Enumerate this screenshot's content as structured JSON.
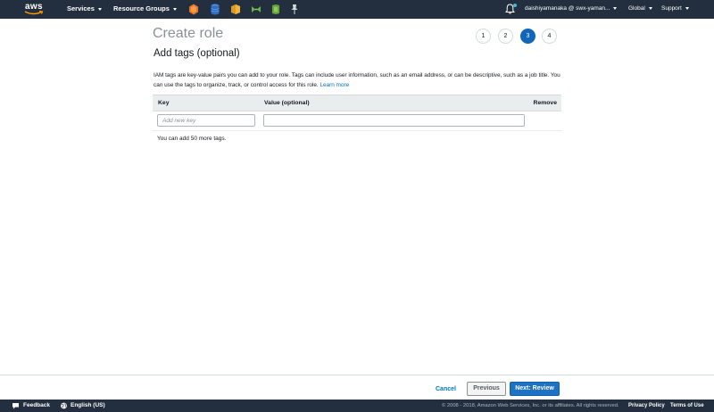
{
  "topnav": {
    "logo": "aws",
    "services_label": "Services",
    "resource_groups_label": "Resource Groups",
    "account_label": "daishiyamanaka @ swx-yaman...",
    "region_label": "Global",
    "support_label": "Support",
    "service_icons": [
      "cloudformation-icon",
      "rds-icon",
      "s3-icon",
      "codepipeline-icon",
      "lambda-icon",
      "pin-icon"
    ],
    "colors": {
      "bar": "#232f3e",
      "bell_dot": "#44b9d6"
    }
  },
  "page": {
    "title": "Create role",
    "section_title": "Add tags (optional)",
    "description": "IAM tags are key-value pairs you can add to your role. Tags can include user information, such as an email address, or can be descriptive, such as a job title. You can use the tags to organize, track, or control access for this role.",
    "learn_more": "Learn more",
    "steps": [
      {
        "label": "1",
        "active": false
      },
      {
        "label": "2",
        "active": false
      },
      {
        "label": "3",
        "active": true
      },
      {
        "label": "4",
        "active": false
      }
    ]
  },
  "tags_table": {
    "headers": {
      "key": "Key",
      "value": "Value (optional)",
      "remove": "Remove"
    },
    "row": {
      "key_placeholder": "Add new key",
      "key_value": "",
      "value_value": ""
    },
    "hint": "You can add 50 more tags."
  },
  "actions": {
    "cancel": "Cancel",
    "previous": "Previous",
    "next": "Next: Review",
    "colors": {
      "primary": "#1d72c4",
      "link": "#0073bb"
    }
  },
  "footer": {
    "feedback": "Feedback",
    "language": "English (US)",
    "copyright": "© 2008 - 2018, Amazon Web Services, Inc. or its affiliates. All rights reserved.",
    "privacy": "Privacy Policy",
    "terms": "Terms of Use"
  }
}
